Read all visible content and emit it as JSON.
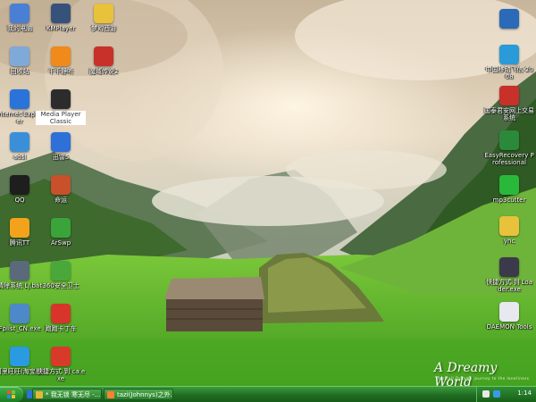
{
  "desktop": {
    "icons_left": [
      {
        "label": "我的电脑",
        "icon": "computer-icon",
        "color": "#4a7fd6"
      },
      {
        "label": "回收站",
        "icon": "recycle-bin-icon",
        "color": "#7fa9d8"
      },
      {
        "label": "Internet Explorer",
        "icon": "internet-explorer-icon",
        "color": "#2a73d8"
      },
      {
        "label": "adsl",
        "icon": "network-connection-icon",
        "color": "#3a8fd8"
      },
      {
        "label": "QQ",
        "icon": "qq-penguin-icon",
        "color": "#1e1e1e"
      },
      {
        "label": "腾讯TT",
        "icon": "tencent-tt-browser-icon",
        "color": "#f2a21b"
      },
      {
        "label": "清除系统 LJ.bat",
        "icon": "batch-file-icon",
        "color": "#5a6a7a"
      },
      {
        "label": "Fplist_CN.exe",
        "icon": "program-window-icon",
        "color": "#4d88c8"
      },
      {
        "label": "阿里旺旺(淘宝版)",
        "icon": "aliwangwang-icon",
        "color": "#2a9be0"
      }
    ],
    "icons_col2": [
      {
        "label": "KMPlayer",
        "icon": "kmplayer-icon",
        "color": "#36527a"
      },
      {
        "label": "千千静听",
        "icon": "ttplayer-icon",
        "color": "#f08a1b"
      },
      {
        "label": "Media Player Classic",
        "icon": "media-player-classic-icon",
        "color": "#2c2c2c",
        "selected": true
      },
      {
        "label": "迅雷5",
        "icon": "thunder-icon",
        "color": "#2f6fd8"
      },
      {
        "label": "命运",
        "icon": "game-shortcut-icon",
        "color": "#c8502a"
      },
      {
        "label": "ArSwp",
        "icon": "arswp-icon",
        "color": "#3aa43a"
      },
      {
        "label": "360安全卫士",
        "icon": "360-safeguard-icon",
        "color": "#4aa83a"
      },
      {
        "label": "跑跑卡丁车",
        "icon": "kartrider-icon",
        "color": "#d8342a"
      },
      {
        "label": "快捷方式 到 ca.exe",
        "icon": "shortcut-ca-icon",
        "color": "#d83a2a"
      }
    ],
    "icons_col3": [
      {
        "label": "梦幻西游",
        "icon": "fantasy-westward-icon",
        "color": "#e8c23a"
      },
      {
        "label": "魔域传说2",
        "icon": "mu-legend-icon",
        "color": "#c8302a"
      }
    ],
    "icons_right": [
      {
        "label": "",
        "icon": "arrow-shortcut-icon",
        "color": "#2a6ab8"
      },
      {
        "label": "中国移动飞信 2008",
        "icon": "fetion-icon",
        "color": "#2a9ad8"
      },
      {
        "label": "国泰君安网上交易系统",
        "icon": "securities-trading-icon",
        "color": "#c8302a"
      },
      {
        "label": "EasyRecovery Professional",
        "icon": "easyrecovery-icon",
        "color": "#2a8a3a"
      },
      {
        "label": "mp3cutter",
        "icon": "mp3cutter-icon",
        "color": "#2ab83a"
      },
      {
        "label": "yhc",
        "icon": "folder-icon",
        "color": "#e8c23a"
      },
      {
        "label": "快捷方式 到 Loader.exe",
        "icon": "loader-shortcut-icon",
        "color": "#3a3a4a"
      },
      {
        "label": "DAEMON Tools",
        "icon": "daemon-tools-icon",
        "color": "#e8e8f0"
      }
    ],
    "watermark": "A Dreamy World",
    "watermark_sub": "A small Dreamy journey to the loneliness"
  },
  "taskbar": {
    "buttons": [
      {
        "label": "* 我无锁 寒无尽 -...",
        "icon": "folder-window-icon",
        "color": "#e8b53a"
      },
      {
        "label": "tazi(Johnnys)之外...",
        "icon": "ie-window-icon",
        "color": "#ff8030"
      }
    ],
    "clock": "1:14"
  }
}
